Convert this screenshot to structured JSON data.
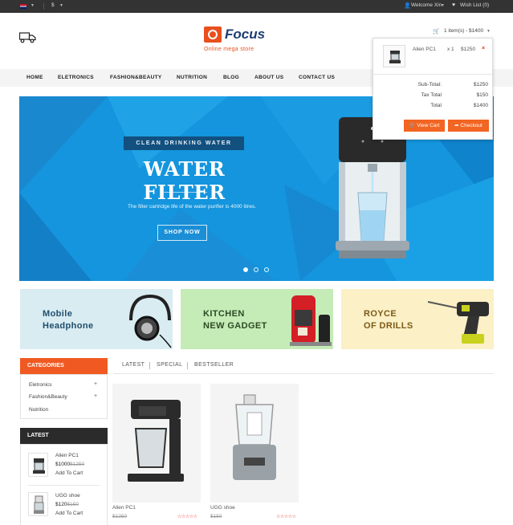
{
  "topbar": {
    "currency": "$",
    "welcome": "Welcome Xin",
    "wishlist": "Wish List (0)"
  },
  "header": {
    "logo_name": "Focus",
    "logo_tagline": "Online mega store",
    "cart_summary": "1 item(s) - $1400"
  },
  "nav": {
    "items": [
      "HOME",
      "ELETRONICS",
      "FASHION&BEAUTY",
      "NUTRITION",
      "BLOG",
      "ABOUT US",
      "CONTACT US"
    ]
  },
  "cart_dropdown": {
    "product_name": "Alien PC1",
    "qty": "x 1",
    "price": "$1250",
    "remove": "×",
    "totals": [
      {
        "label": "Sub-Total:",
        "value": "$1250"
      },
      {
        "label": "Tax Total",
        "value": "$150"
      },
      {
        "label": "Total",
        "value": "$1400"
      }
    ],
    "view_cart": "View Cart",
    "checkout": "Checkout"
  },
  "hero": {
    "tagline": "CLEAN DRINKING WATER",
    "title": "WATER FILTER",
    "description": "The filter cartridge life of the water purifier is 4000 litres.",
    "button": "SHOP NOW",
    "slide_count": 3,
    "active_slide": 1
  },
  "banners": [
    {
      "line1": "Mobile",
      "line2": "Headphone",
      "bg": "#d9ecf2",
      "color": "#1f4d6b"
    },
    {
      "line1": "KITCHEN",
      "line2": "NEW GADGET",
      "bg": "#c5ecb7",
      "color": "#2d4a24"
    },
    {
      "line1": "ROYCE",
      "line2": "OF DRILLS",
      "bg": "#fbf0c6",
      "color": "#7c5a18"
    }
  ],
  "categories": {
    "title": "CATEGORIES",
    "items": [
      {
        "label": "Eletronics",
        "expand": "+"
      },
      {
        "label": "Fashion&Beauty",
        "expand": "+"
      },
      {
        "label": "Nutrition",
        "expand": ""
      }
    ]
  },
  "latest": {
    "title": "LATEST",
    "items": [
      {
        "name": "Alien PC1",
        "price": "$1000",
        "old_price": "$1250",
        "add": "Add To Cart"
      },
      {
        "name": "UGG shoe",
        "price": "$120",
        "old_price": "$150",
        "add": "Add To Cart"
      }
    ]
  },
  "tabs": [
    "LATEST",
    "SPECIAL",
    "BESTSELLER"
  ],
  "products": [
    {
      "name": "Alien PC1",
      "old_price": "$1250",
      "rating": 0
    },
    {
      "name": "UGG shoe",
      "old_price": "$150",
      "rating": 0
    }
  ],
  "colors": {
    "accent": "#f05a22",
    "hero_bg": "#1495dd",
    "topbar": "#333333"
  }
}
